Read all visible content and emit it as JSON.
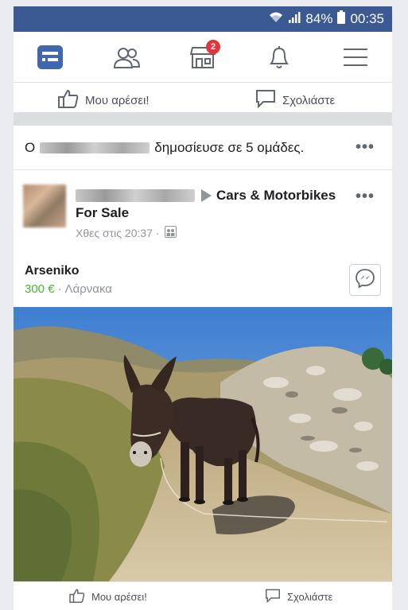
{
  "status_bar": {
    "battery_percent": "84%",
    "time": "00:35",
    "bg_color": "#3b5a94"
  },
  "nav": {
    "items": [
      {
        "name": "news-feed",
        "icon": "news-feed-icon",
        "active": true
      },
      {
        "name": "friends",
        "icon": "friends-icon"
      },
      {
        "name": "marketplace",
        "icon": "marketplace-icon",
        "badge": "2"
      },
      {
        "name": "notifications",
        "icon": "bell-icon"
      },
      {
        "name": "menu",
        "icon": "hamburger-icon"
      }
    ],
    "active_color": "#4267b2"
  },
  "prev_post_actions": {
    "like_label": "Μου αρέσει!",
    "comment_label": "Σχολιάστε"
  },
  "share_header": {
    "prefix": "Ο",
    "suffix": "δημοσίευσε σε 5 ομάδες.",
    "more": "•••"
  },
  "post": {
    "group_name": "Cars & Motorbikes",
    "subtitle": "For Sale",
    "timestamp": "Χθες στις 20:37 ·",
    "more": "•••",
    "item_title": "Arseniko",
    "price": "300 €",
    "separator": "·",
    "location": "Λάρνακα",
    "price_color": "#42b72a"
  },
  "post_actions": {
    "like_label": "Μου αρέσει!",
    "comment_label": "Σχολιάστε"
  }
}
